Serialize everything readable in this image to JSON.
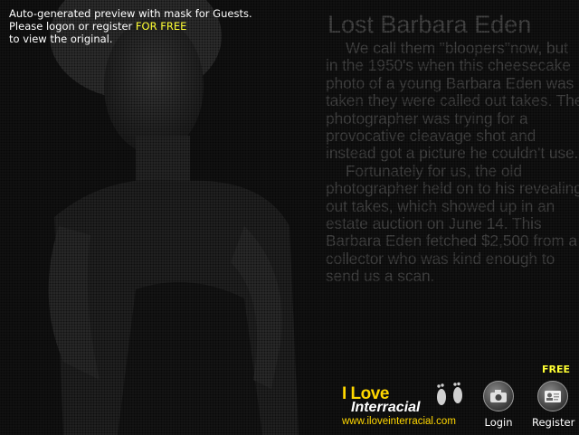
{
  "notice": {
    "line1": "Auto-generated preview with mask for Guests.",
    "line2_prefix": "Please logon or register ",
    "line2_free": "FOR FREE",
    "line3": "to view the original."
  },
  "article": {
    "title": "Lost Barbara Eden",
    "paragraph1": "We call them \"bloopers\"now, but in the 1950's when this cheesecake photo of a young Barbara Eden was taken they were called out takes.  The photographer was trying for a provocative cleavage shot and instead got a picture he couldn't use.",
    "paragraph2": "Fortunately for us, the old photographer held on to his revealing out takes, which showed up in an estate auction on June 14.  This Barbara Eden fetched $2,500 from a collector who was kind enough to send us a scan."
  },
  "brand": {
    "line1": "I Love",
    "line2": "Interracial",
    "url": "www.iloveinterracial.com"
  },
  "actions": {
    "free_tag": "FREE",
    "login_label": "Login",
    "register_label": "Register",
    "login_icon": "camera-icon",
    "register_icon": "id-card-icon"
  },
  "colors": {
    "highlight": "#ffff33",
    "brand_yellow": "#ffd700"
  }
}
